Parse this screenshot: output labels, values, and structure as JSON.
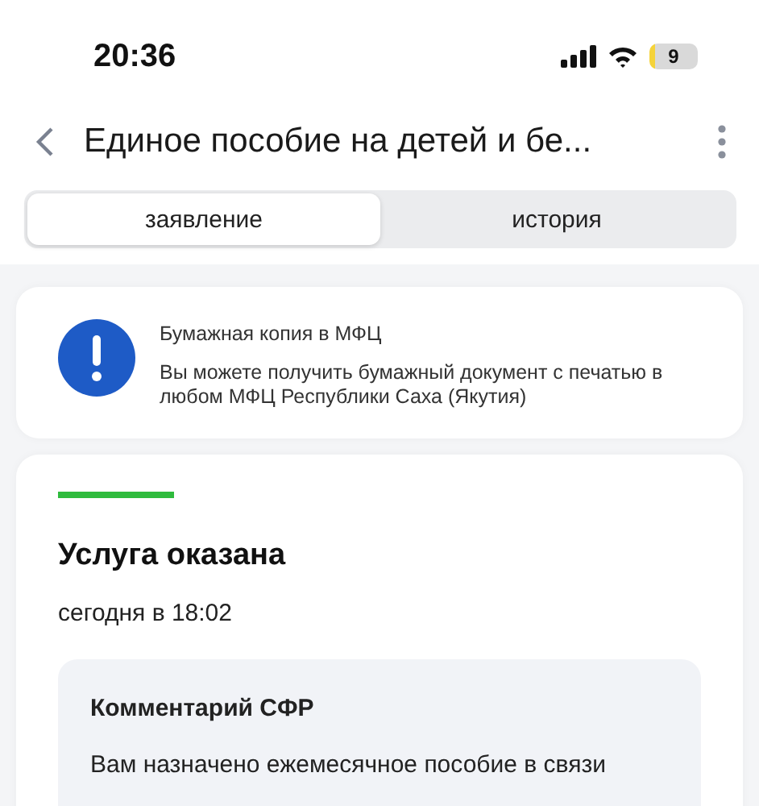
{
  "status_bar": {
    "time": "20:36",
    "battery": "9"
  },
  "header": {
    "title": "Единое пособие на детей и бе..."
  },
  "tabs": [
    {
      "label": "заявление",
      "selected": true
    },
    {
      "label": "история",
      "selected": false
    }
  ],
  "notice": {
    "title": "Бумажная копия в МФЦ",
    "text": "Вы можете получить бумажный документ с печатью в любом МФЦ Республики Саха (Якутия)"
  },
  "status_card": {
    "title": "Услуга оказана",
    "time": "сегодня в 18:02",
    "comment": {
      "title": "Комментарий СФР",
      "text": "Вам назначено ежемесячное пособие в связи"
    }
  }
}
